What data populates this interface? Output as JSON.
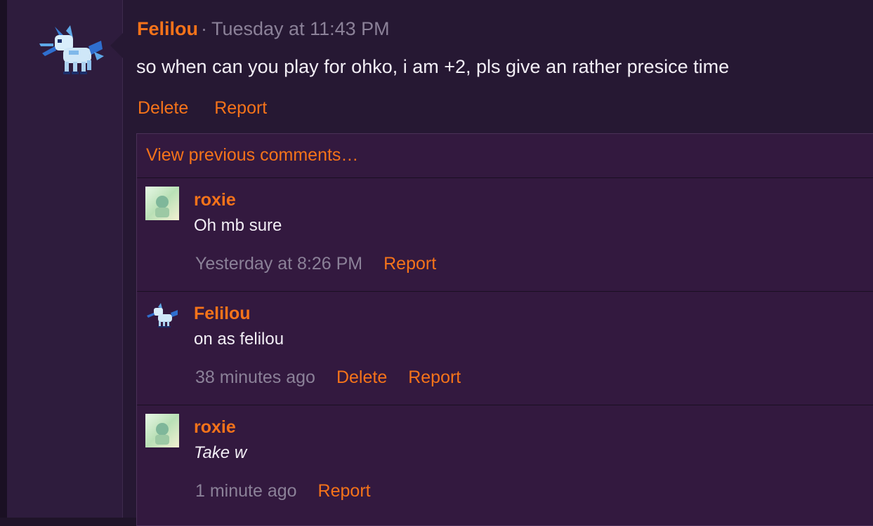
{
  "post": {
    "author": "Felilou",
    "separator": "·",
    "time": "Tuesday at 11:43 PM",
    "text": "so when can you play for ohko, i am +2, pls give an rather presice time",
    "actions": {
      "delete": "Delete",
      "report": "Report"
    }
  },
  "comments_section": {
    "view_previous": "View previous comments…",
    "items": [
      {
        "author": "roxie",
        "text": "Oh mb sure",
        "time": "Yesterday at 8:26 PM",
        "report": "Report"
      },
      {
        "author": "Felilou",
        "text": "on as felilou",
        "time": "38 minutes ago",
        "delete": "Delete",
        "report": "Report"
      },
      {
        "author": "roxie",
        "text": "Take w",
        "time": "1 minute ago",
        "report": "Report"
      }
    ]
  },
  "colors": {
    "accent": "#f5731a",
    "muted": "#8b8198",
    "text": "#f2eef5",
    "message_bg": "#261833",
    "comments_bg": "#33193f"
  },
  "icons": {
    "author_avatar": "glaceon-sprite-icon",
    "commenter_avatar": "roxie-avatar-icon"
  }
}
